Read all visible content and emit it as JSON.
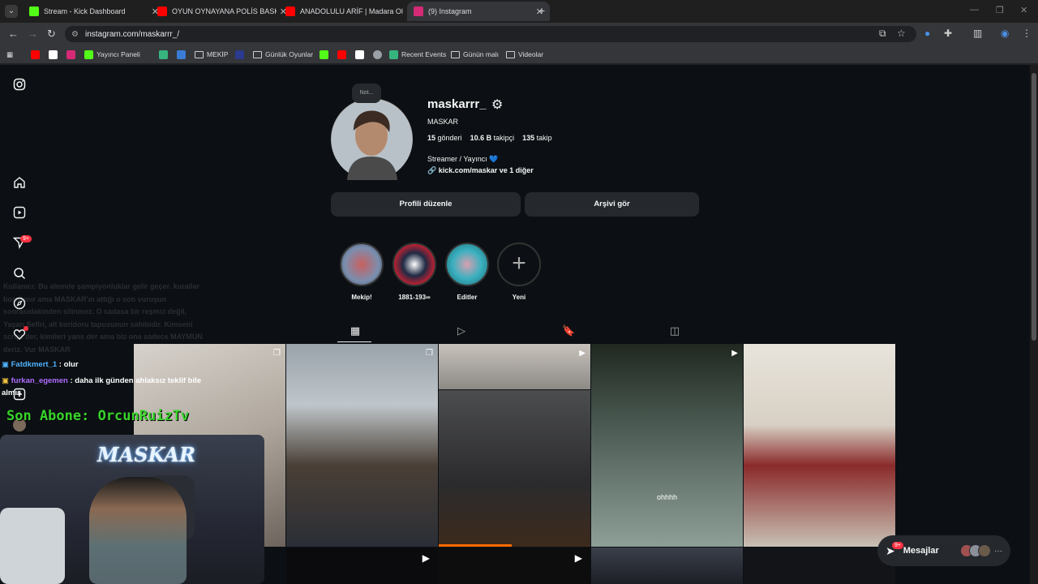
{
  "browser": {
    "tabs": [
      {
        "title": "Stream - Kick Dashboard",
        "favicon_color": "#53fc18"
      },
      {
        "title": "OYUN OYNAYANA POLİS BASKI",
        "favicon_color": "#ff0000"
      },
      {
        "title": "ANADOLULU ARİF | Madara Ol",
        "favicon_color": "#ff0000"
      },
      {
        "title": "(9) Instagram",
        "favicon_color": "#d62976"
      }
    ],
    "new_tab": "+",
    "url": "instagram.com/maskarrr_/",
    "bookmarks": [
      {
        "label": "",
        "color": "#ff0000"
      },
      {
        "label": "",
        "color": "#ffffff"
      },
      {
        "label": "",
        "color": "#d62976"
      },
      {
        "label": "Yayıncı Paneli",
        "color": "#53fc18"
      },
      {
        "label": "",
        "color": "#36b37e"
      },
      {
        "label": "",
        "color": "#3a7bd5"
      },
      {
        "label": "MEKİP",
        "type": "folder"
      },
      {
        "label": "",
        "color": "#2b3a8f"
      },
      {
        "label": "Günlük Oyunlar",
        "type": "folder"
      },
      {
        "label": "",
        "color": "#53fc18"
      },
      {
        "label": "",
        "color": "#ff0000"
      },
      {
        "label": "",
        "color": "#ffffff"
      },
      {
        "label": "",
        "color": "#9aa0a6"
      },
      {
        "label": "Recent Events",
        "color": "#36b37e"
      },
      {
        "label": "Günün malı",
        "type": "folder"
      },
      {
        "label": "Videolar",
        "type": "folder"
      }
    ]
  },
  "profile": {
    "note": "Not...",
    "username": "maskarrr_",
    "display_name": "MASKAR",
    "posts_count": "15",
    "posts_label": "gönderi",
    "followers_count": "10.6 B",
    "followers_label": "takipçi",
    "following_count": "135",
    "following_label": "takip",
    "bio": "Streamer / Yayıncı",
    "link": "kick.com/maskar ve 1 diğer",
    "edit_button": "Profili düzenle",
    "archive_button": "Arşivi gör"
  },
  "highlights": [
    {
      "label": "Mekip!"
    },
    {
      "label": "1881-193∞"
    },
    {
      "label": "Editler"
    },
    {
      "label": "Yeni"
    }
  ],
  "overlay": {
    "ghost_text": "Kullanıcı: Bu alemde şampiyonluklar gelir geçer. kurallar bozulanır ama MASKAR'ın attığı o son vuruşun sonrasıdakinden silinmez. O cadasa bir reşmci değil, Yaşan Sefiri, alt koridoru tapusunun sahibidir. Kimseni script der, kimileri yans der ama biz ona sadece MAYMUN deriz. Vur MASKAR",
    "chat": [
      {
        "user": "Fatdkmert_1",
        "msg": ": olur"
      },
      {
        "user": "furkan_egemen",
        "msg": ": daha ilk günden ahlaksız teklif bile almış"
      }
    ],
    "sub_alert": "Son Abone: OrcunRuizTv",
    "cam_sign": "MASKAR"
  },
  "messages": {
    "label": "Mesajlar",
    "badge": "9+"
  },
  "nav_badge": "9+",
  "post_overlay_text": "ohhhh"
}
